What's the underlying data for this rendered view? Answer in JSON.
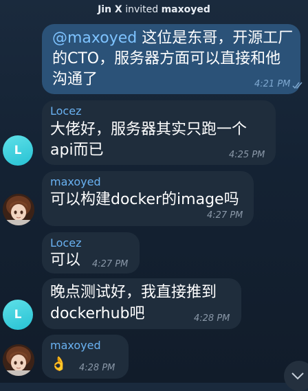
{
  "service": {
    "inviter": "Jin X",
    "verb": "invited",
    "invitee": "maxoyed"
  },
  "messages": [
    {
      "direction": "outgoing",
      "mention": "@maxoyed",
      "line1_rest": " 这位是东哥，开源工厂",
      "line2": "的CTO，服务器方面可以直接和他",
      "line3": "沟通了",
      "time": "4:21 PM",
      "status_icon": "double-check-icon"
    },
    {
      "direction": "incoming",
      "sender": "Locez",
      "line1": "大佬好，服务器其实只跑一个",
      "line2": "api而已",
      "time": "4:25 PM",
      "avatar_letter": "L"
    },
    {
      "direction": "incoming",
      "sender": "maxoyed",
      "line1": "可以构建docker的image吗",
      "time": "4:27 PM"
    },
    {
      "direction": "incoming",
      "sender": "Locez",
      "line1": "可以",
      "time": "4:27 PM"
    },
    {
      "direction": "incoming",
      "line1": "晚点测试好，我直接推到",
      "line2": "dockerhub吧",
      "time": "4:28 PM",
      "avatar_letter": "L"
    },
    {
      "direction": "incoming",
      "sender": "maxoyed",
      "line1": "👌",
      "time": "4:28 PM"
    }
  ],
  "colors": {
    "outgoing_bubble": "#2b5278",
    "incoming_bubble": "#1f2d3c",
    "sender_name": "#6ab2f2",
    "avatar_locez": "#2fc8d8"
  },
  "icons": {
    "scroll_down": "chevron-down-icon"
  }
}
